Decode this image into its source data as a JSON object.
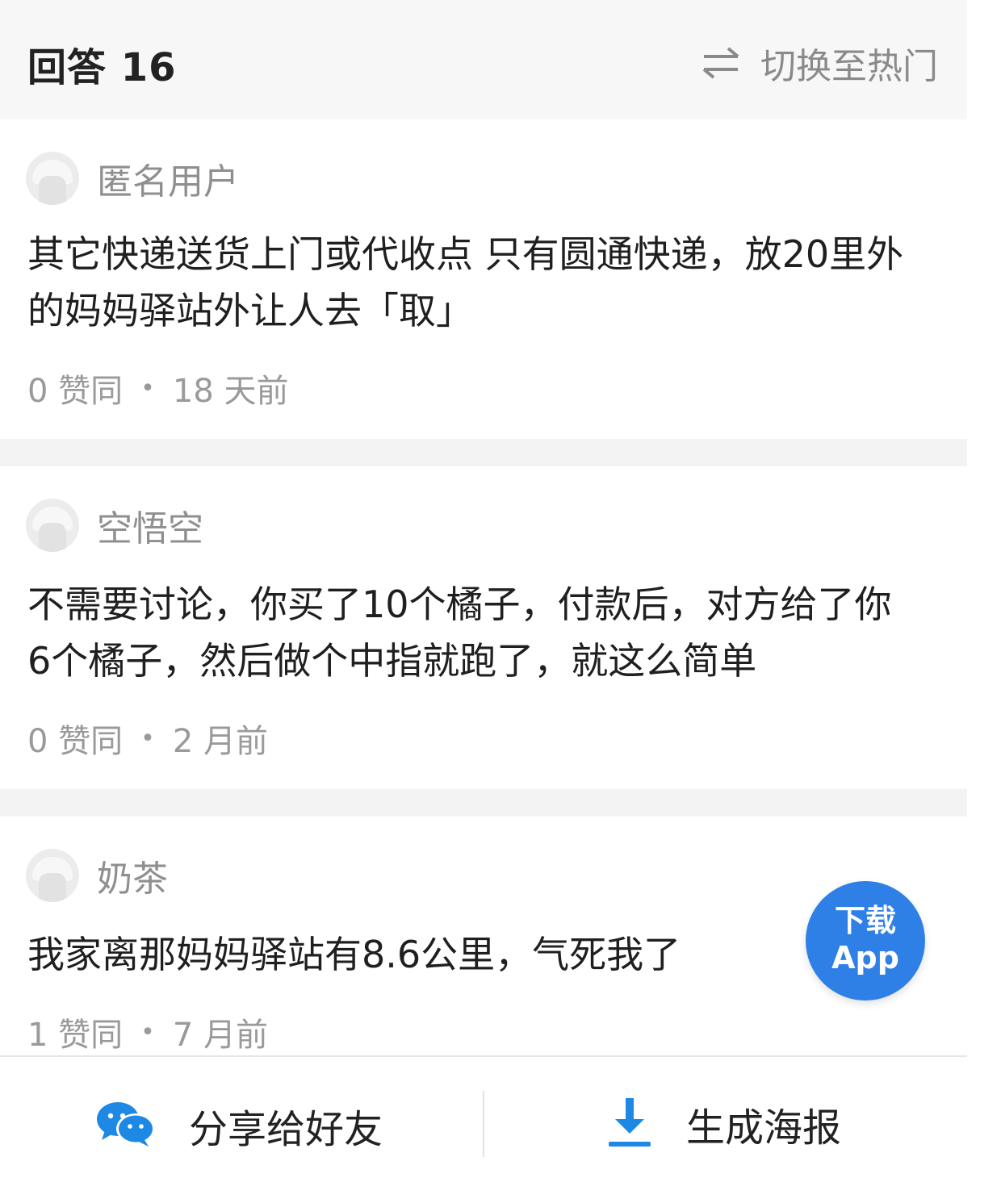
{
  "header": {
    "title": "回答 16",
    "switch_label": "切换至热门"
  },
  "answers": [
    {
      "username": "匿名用户",
      "content": "其它快递送货上门或代收点 只有圆通快递，放20里外的妈妈驿站外让人去「取」",
      "likes": "0 赞同",
      "time": "18 天前"
    },
    {
      "username": "空悟空",
      "content": "不需要讨论，你买了10个橘子，付款后，对方给了你6个橘子，然后做个中指就跑了，就这么简单",
      "likes": "0 赞同",
      "time": "2 月前"
    },
    {
      "username": "奶茶",
      "content": "我家离那妈妈驿站有8.6公里，气死我了",
      "likes": "1 赞同",
      "time": "7 月前"
    }
  ],
  "fab": {
    "line1": "下载",
    "line2": "App"
  },
  "bottom_bar": {
    "share_label": "分享给好友",
    "poster_label": "生成海报"
  },
  "colors": {
    "accent": "#2f80e6",
    "wechat": "#1e88e5",
    "text_muted": "#9a9a9a"
  },
  "icons": {
    "switch": "swap-arrows-icon",
    "share": "wechat-icon",
    "poster": "download-icon"
  }
}
